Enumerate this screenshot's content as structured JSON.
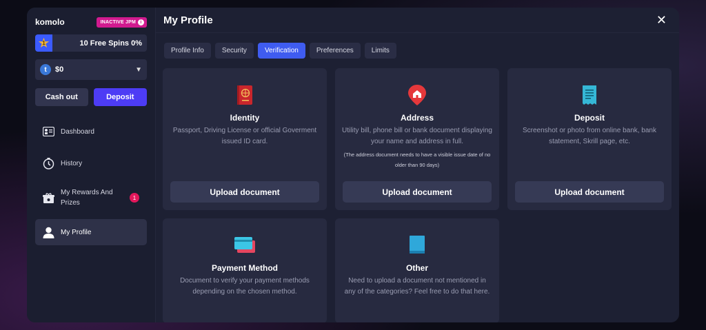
{
  "sidebar": {
    "brand": "komolo",
    "badge": "INACTIVE JPM",
    "spins": {
      "level": "1",
      "text": "10 Free Spins 0%"
    },
    "wallet": {
      "currency_symbol": "t",
      "amount": "$0"
    },
    "buttons": {
      "cashout": "Cash out",
      "deposit": "Deposit"
    },
    "nav": [
      {
        "label": "Dashboard"
      },
      {
        "label": "History"
      },
      {
        "label": "My Rewards And Prizes",
        "count": "1"
      },
      {
        "label": "My Profile"
      }
    ]
  },
  "header": {
    "title": "My Profile",
    "close": "✕"
  },
  "tabs": [
    {
      "label": "Profile Info"
    },
    {
      "label": "Security"
    },
    {
      "label": "Verification"
    },
    {
      "label": "Preferences"
    },
    {
      "label": "Limits"
    }
  ],
  "cards": [
    {
      "title": "Identity",
      "desc": "Passport, Driving License or official Goverment issued ID card.",
      "button": "Upload document"
    },
    {
      "title": "Address",
      "desc": "Utility bill, phone bill or bank document displaying your name and address in full.",
      "note": "(The address document needs to have a visible issue date of no older than 90 days)",
      "button": "Upload document"
    },
    {
      "title": "Deposit",
      "desc": "Screenshot or photo from online bank, bank statement, Skrill page, etc.",
      "button": "Upload document"
    },
    {
      "title": "Payment Method",
      "desc": "Document to verify your payment methods depending on the chosen method."
    },
    {
      "title": "Other",
      "desc": "Need to upload a document not mentioned in any of the categories? Feel free to do that here."
    }
  ],
  "colors": {
    "accent": "#4d3cf5",
    "tab_active": "#3f5cf0",
    "badge": "#d21a8f",
    "count": "#e2175b"
  }
}
